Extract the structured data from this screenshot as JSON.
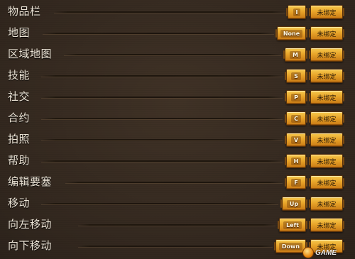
{
  "keybind_rows": [
    {
      "action": "物品栏",
      "key": "I",
      "secondary": "未绑定"
    },
    {
      "action": "地图",
      "key": "None",
      "secondary": "未绑定"
    },
    {
      "action": "区域地图",
      "key": "M",
      "secondary": "未绑定"
    },
    {
      "action": "技能",
      "key": "S",
      "secondary": "未绑定"
    },
    {
      "action": "社交",
      "key": "P",
      "secondary": "未绑定"
    },
    {
      "action": "合约",
      "key": "C",
      "secondary": "未绑定"
    },
    {
      "action": "拍照",
      "key": "V",
      "secondary": "未绑定"
    },
    {
      "action": "帮助",
      "key": "H",
      "secondary": "未绑定"
    },
    {
      "action": "编辑要塞",
      "key": "F",
      "secondary": "未绑定"
    },
    {
      "action": "移动",
      "key": "Up",
      "secondary": "未绑定"
    },
    {
      "action": "向左移动",
      "key": "Left",
      "secondary": "未绑定"
    },
    {
      "action": "向下移动",
      "key": "Down",
      "secondary": "未绑定"
    }
  ],
  "watermark": {
    "text": "GAME"
  },
  "colors": {
    "background": "#3a2e24",
    "button_gold": "#e8a52a",
    "label_text": "#ece4d6"
  }
}
